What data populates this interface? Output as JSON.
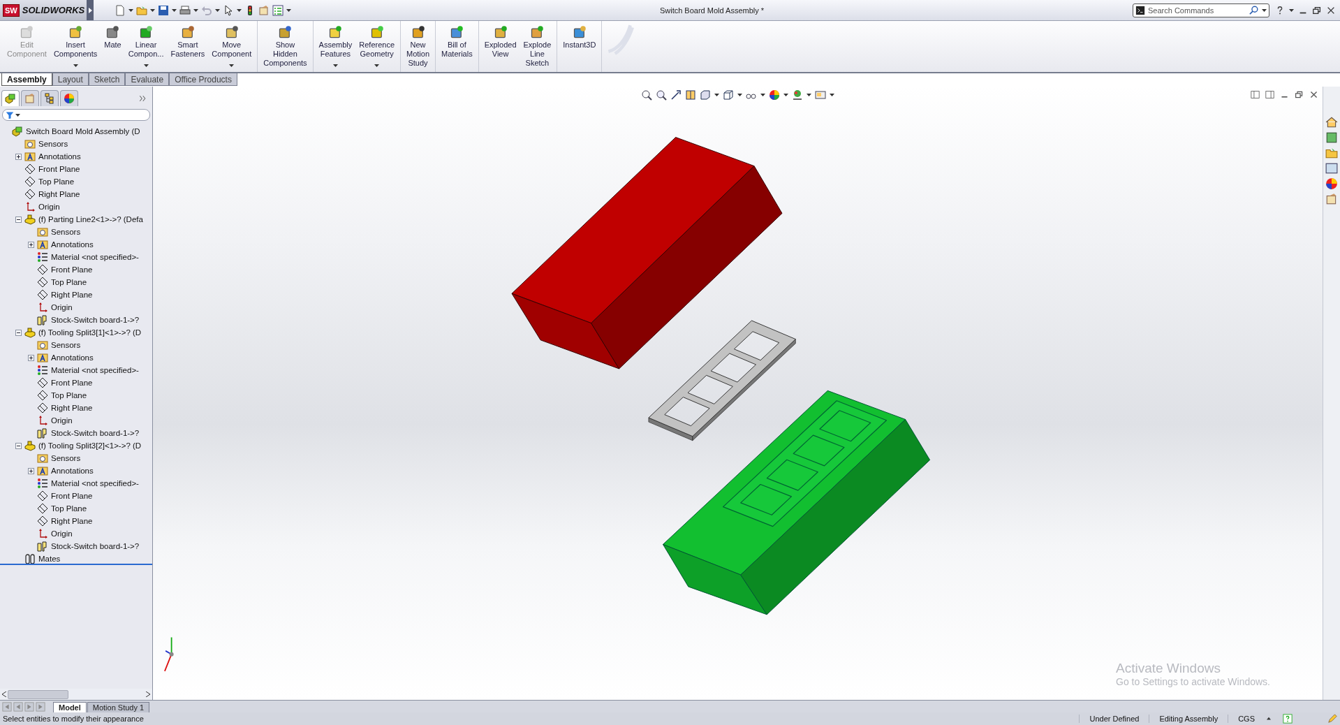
{
  "window": {
    "title": "Switch Board Mold Assembly *"
  },
  "logo": {
    "badge": "SW",
    "name": "SOLIDWORKS"
  },
  "search": {
    "placeholder": "Search Commands"
  },
  "command_groups": [
    {
      "buttons": [
        {
          "label": "Edit Component",
          "disabled": true,
          "menu": false
        },
        {
          "label": "Insert Components",
          "disabled": false,
          "menu": true
        },
        {
          "label": "Mate",
          "disabled": false,
          "menu": false
        },
        {
          "label": "Linear Compon...",
          "disabled": false,
          "menu": true
        },
        {
          "label": "Smart Fasteners",
          "disabled": false,
          "menu": false
        },
        {
          "label": "Move Component",
          "disabled": false,
          "menu": true
        }
      ]
    },
    {
      "buttons": [
        {
          "label": "Show Hidden Components",
          "disabled": false,
          "menu": false
        }
      ]
    },
    {
      "buttons": [
        {
          "label": "Assembly Features",
          "disabled": false,
          "menu": true
        },
        {
          "label": "Reference Geometry",
          "disabled": false,
          "menu": true
        }
      ]
    },
    {
      "buttons": [
        {
          "label": "New Motion Study",
          "disabled": false,
          "menu": false
        }
      ]
    },
    {
      "buttons": [
        {
          "label": "Bill of Materials",
          "disabled": false,
          "menu": false
        }
      ]
    },
    {
      "buttons": [
        {
          "label": "Exploded View",
          "disabled": false,
          "menu": false
        },
        {
          "label": "Explode Line Sketch",
          "disabled": false,
          "menu": false
        }
      ]
    },
    {
      "buttons": [
        {
          "label": "Instant3D",
          "disabled": false,
          "menu": false
        }
      ]
    }
  ],
  "tabs": [
    {
      "label": "Assembly",
      "selected": true
    },
    {
      "label": "Layout",
      "selected": false
    },
    {
      "label": "Sketch",
      "selected": false
    },
    {
      "label": "Evaluate",
      "selected": false
    },
    {
      "label": "Office Products",
      "selected": false
    }
  ],
  "panel_tabs": [
    {
      "selected": true
    },
    {
      "selected": false
    },
    {
      "selected": false
    },
    {
      "selected": false
    }
  ],
  "tree": {
    "items": [
      {
        "label": "Switch Board Mold Assembly (D",
        "kind": "assembly",
        "children": [
          {
            "label": "Sensors",
            "kind": "sensors"
          },
          {
            "label": "Annotations",
            "kind": "annotations",
            "expanded": false
          },
          {
            "label": "Front Plane",
            "kind": "plane"
          },
          {
            "label": "Top Plane",
            "kind": "plane"
          },
          {
            "label": "Right Plane",
            "kind": "plane"
          },
          {
            "label": "Origin",
            "kind": "origin"
          },
          {
            "label": "(f) Parting Line2<1>->? (Defa",
            "kind": "part",
            "expanded": true,
            "children": [
              {
                "label": "Sensors",
                "kind": "sensors"
              },
              {
                "label": "Annotations",
                "kind": "annotations",
                "expanded": false
              },
              {
                "label": "Material <not specified>-",
                "kind": "material"
              },
              {
                "label": "Front Plane",
                "kind": "plane"
              },
              {
                "label": "Top Plane",
                "kind": "plane"
              },
              {
                "label": "Right Plane",
                "kind": "plane"
              },
              {
                "label": "Origin",
                "kind": "origin"
              },
              {
                "label": "Stock-Switch board-1->?",
                "kind": "body"
              }
            ]
          },
          {
            "label": "(f) Tooling Split3[1]<1>->? (D",
            "kind": "part",
            "expanded": true,
            "children": [
              {
                "label": "Sensors",
                "kind": "sensors"
              },
              {
                "label": "Annotations",
                "kind": "annotations",
                "expanded": false
              },
              {
                "label": "Material <not specified>-",
                "kind": "material"
              },
              {
                "label": "Front Plane",
                "kind": "plane"
              },
              {
                "label": "Top Plane",
                "kind": "plane"
              },
              {
                "label": "Right Plane",
                "kind": "plane"
              },
              {
                "label": "Origin",
                "kind": "origin"
              },
              {
                "label": "Stock-Switch board-1->?",
                "kind": "body"
              }
            ]
          },
          {
            "label": "(f) Tooling Split3[2]<1>->? (D",
            "kind": "part",
            "expanded": true,
            "children": [
              {
                "label": "Sensors",
                "kind": "sensors"
              },
              {
                "label": "Annotations",
                "kind": "annotations",
                "expanded": false
              },
              {
                "label": "Material <not specified>-",
                "kind": "material"
              },
              {
                "label": "Front Plane",
                "kind": "plane"
              },
              {
                "label": "Top Plane",
                "kind": "plane"
              },
              {
                "label": "Right Plane",
                "kind": "plane"
              },
              {
                "label": "Origin",
                "kind": "origin"
              },
              {
                "label": "Stock-Switch board-1->?",
                "kind": "body"
              }
            ]
          },
          {
            "label": "Mates",
            "kind": "mates"
          }
        ]
      }
    ]
  },
  "bottom_tabs": [
    {
      "label": "Model",
      "selected": true
    },
    {
      "label": "Motion Study 1",
      "selected": false
    }
  ],
  "status_bar": {
    "message": "Select entities to modify their appearance",
    "items": [
      "Under Defined",
      "Editing Assembly",
      "CGS"
    ]
  },
  "activation_notice": {
    "title": "Activate Windows",
    "message": "Go to Settings to activate Windows."
  }
}
